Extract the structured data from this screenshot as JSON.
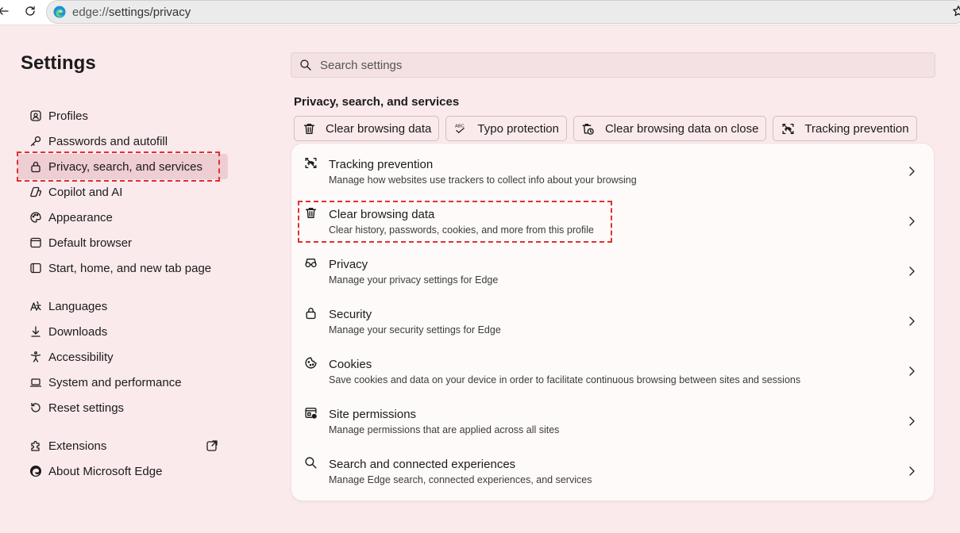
{
  "address_bar": {
    "url_prefix": "edge://",
    "url_path": "settings/privacy"
  },
  "sidebar": {
    "title": "Settings",
    "groups": [
      [
        {
          "label": "Profiles",
          "icon": "profile-icon"
        },
        {
          "label": "Passwords and autofill",
          "icon": "key-icon"
        },
        {
          "label": "Privacy, search, and services",
          "icon": "lock-icon",
          "active": true
        },
        {
          "label": "Copilot and AI",
          "icon": "copilot-icon"
        },
        {
          "label": "Appearance",
          "icon": "palette-icon"
        },
        {
          "label": "Default browser",
          "icon": "browser-window-icon"
        },
        {
          "label": "Start, home, and new tab page",
          "icon": "start-page-icon"
        }
      ],
      [
        {
          "label": "Languages",
          "icon": "languages-icon"
        },
        {
          "label": "Downloads",
          "icon": "download-icon"
        },
        {
          "label": "Accessibility",
          "icon": "accessibility-icon"
        },
        {
          "label": "System and performance",
          "icon": "laptop-icon"
        },
        {
          "label": "Reset settings",
          "icon": "reset-icon"
        }
      ],
      [
        {
          "label": "Extensions",
          "icon": "puzzle-icon",
          "external": true
        },
        {
          "label": "About Microsoft Edge",
          "icon": "edge-logo-icon"
        }
      ]
    ]
  },
  "search": {
    "placeholder": "Search settings"
  },
  "main": {
    "section_title": "Privacy, search, and services",
    "chips": [
      {
        "label": "Clear browsing data",
        "icon": "trash-icon"
      },
      {
        "label": "Typo protection",
        "icon": "spellcheck-icon",
        "icon_text": "ABC"
      },
      {
        "label": "Clear browsing data on close",
        "icon": "trash-clock-icon"
      },
      {
        "label": "Tracking prevention",
        "icon": "tracking-icon"
      }
    ],
    "rows": [
      {
        "title": "Tracking prevention",
        "desc": "Manage how websites use trackers to collect info about your browsing",
        "icon": "tracking-icon"
      },
      {
        "title": "Clear browsing data",
        "desc": "Clear history, passwords, cookies, and more from this profile",
        "icon": "trash-icon"
      },
      {
        "title": "Privacy",
        "desc": "Manage your privacy settings for Edge",
        "icon": "glasses-icon"
      },
      {
        "title": "Security",
        "desc": "Manage your security settings for Edge",
        "icon": "lock-icon"
      },
      {
        "title": "Cookies",
        "desc": "Save cookies and data on your device in order to facilitate continuous browsing between sites and sessions",
        "icon": "cookie-icon"
      },
      {
        "title": "Site permissions",
        "desc": "Manage permissions that are applied across all sites",
        "icon": "site-permissions-icon"
      },
      {
        "title": "Search and connected experiences",
        "desc": "Manage Edge search, connected experiences, and services",
        "icon": "search-icon"
      }
    ]
  },
  "colors": {
    "page_bg": "#fbeaec",
    "active_item_bg": "#eecdd3",
    "highlight_dashed": "#e0302f",
    "card_bg": "#fffafa"
  }
}
